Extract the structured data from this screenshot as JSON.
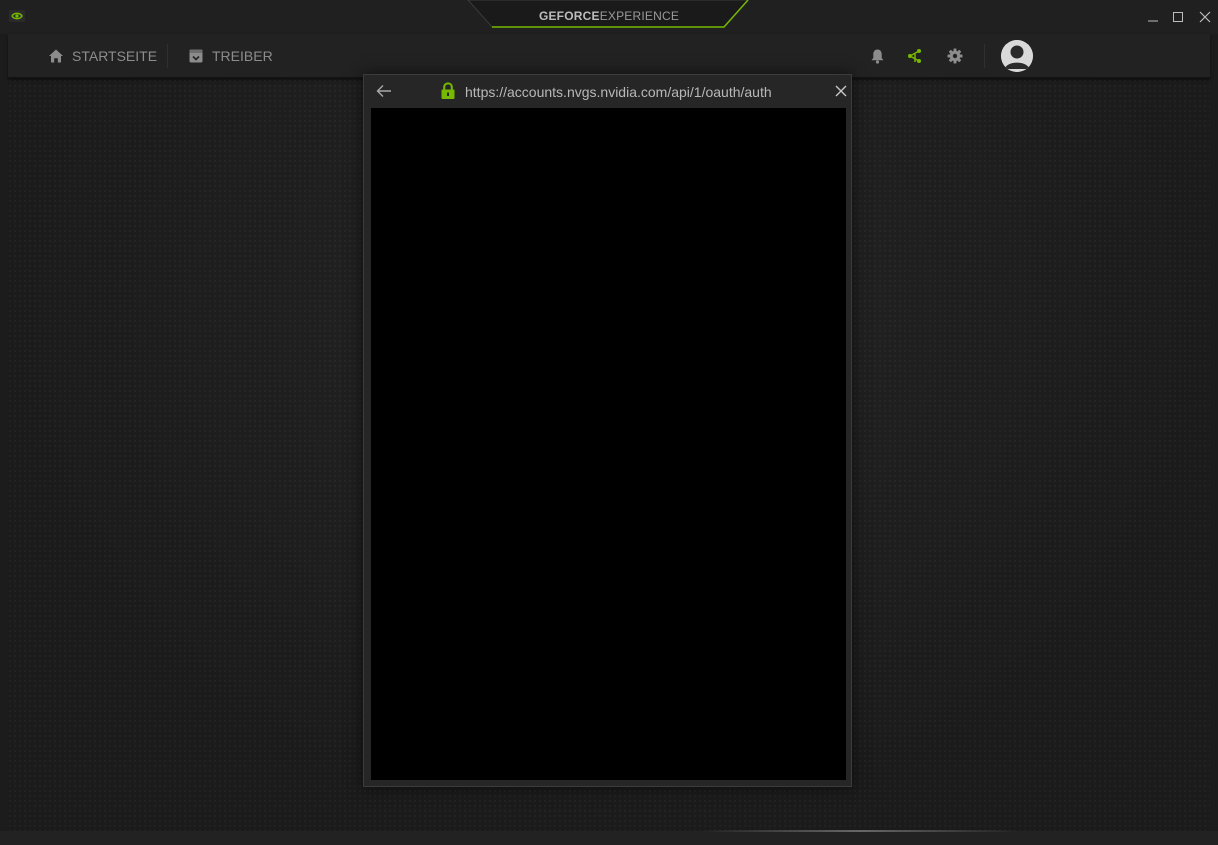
{
  "app": {
    "brand_primary": "GEFORCE",
    "brand_secondary": "EXPERIENCE",
    "accent_color": "#76b900"
  },
  "window_controls": {
    "minimize_icon": "minimize-icon",
    "maximize_icon": "maximize-icon",
    "close_icon": "close-icon"
  },
  "nav": {
    "home_label": "STARTSEITE",
    "home_icon": "home-icon",
    "drivers_label": "TREIBER",
    "drivers_icon": "driver-box-icon",
    "notifications_icon": "bell-icon",
    "share_icon": "share-icon",
    "settings_icon": "gear-icon",
    "avatar_icon": "user-avatar-icon"
  },
  "auth_dialog": {
    "back_icon": "back-arrow-icon",
    "lock_icon": "lock-icon",
    "url": "https://accounts.nvgs.nvidia.com/api/1/oauth/auth",
    "close_icon": "close-icon"
  }
}
